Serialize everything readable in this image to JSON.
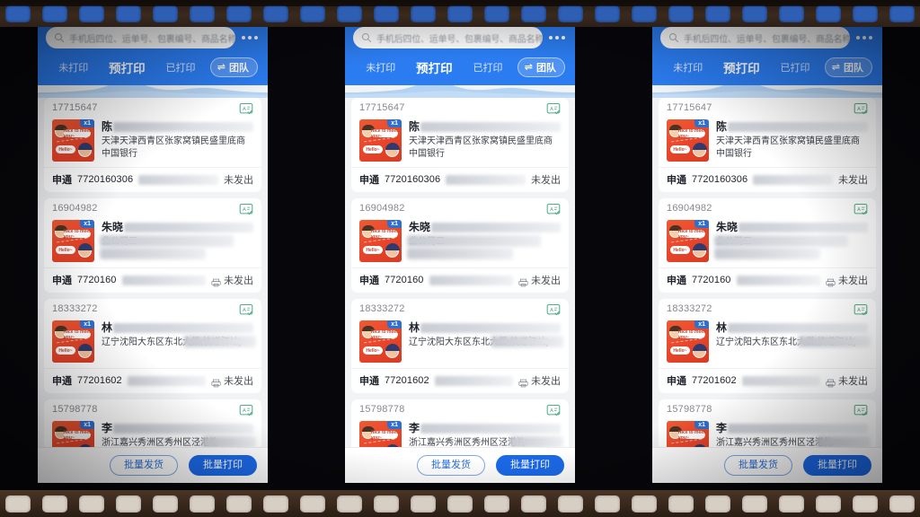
{
  "app": {
    "accent_blue": "#2b7cf0",
    "primary_button_blue": "#1b69e8",
    "status_green": "#3fa87a"
  },
  "search": {
    "placeholder": "手机后四位、运单号、包裹编号、商品名称",
    "icon": "search-icon",
    "more_icon": "more-dots-icon"
  },
  "tabs": [
    {
      "label": "未打印",
      "active": false
    },
    {
      "label": "预打印",
      "active": true
    },
    {
      "label": "已打印",
      "active": false
    }
  ],
  "team_button": {
    "label": "团队",
    "icon": "swap-icon",
    "glyph": "⇌"
  },
  "orders": [
    {
      "order_id": "17715647",
      "qty_badge": "x1",
      "name_visible": "陈",
      "address": "天津天津西青区张家窝镇民盛里底商中国银行",
      "carrier": "申通",
      "tracking": "7720160306",
      "status": "未发出",
      "has_printer_icon": false,
      "card_icon": "id-card-check-icon",
      "thumb_bubble_1": "Nice to meet you~",
      "thumb_bubble_2": "Hello~"
    },
    {
      "order_id": "16904982",
      "qty_badge": "x1",
      "name_visible": "朱晓",
      "address": "业公司三",
      "carrier": "申通",
      "tracking": "7720160",
      "status": "未发出",
      "has_printer_icon": true,
      "card_icon": "id-card-check-icon",
      "thumb_bubble_1": "Nice to meet you~",
      "thumb_bubble_2": "Hello~"
    },
    {
      "order_id": "18333272",
      "qty_badge": "x1",
      "name_visible": "林",
      "address": "辽宁沈阳大东区东北大巢,快递驿站)",
      "carrier": "申通",
      "tracking": "77201602",
      "status": "未发出",
      "has_printer_icon": true,
      "card_icon": "id-card-check-icon",
      "thumb_bubble_1": "Nice to meet you~",
      "thumb_bubble_2": "Hello~"
    },
    {
      "order_id": "15798778",
      "qty_badge": "x1",
      "name_visible": "李",
      "address": "浙江嘉兴秀洲区秀州区泾港礼",
      "carrier": "",
      "tracking": "",
      "status": "",
      "has_printer_icon": false,
      "card_icon": "id-card-check-icon",
      "thumb_bubble_1": "Nice to meet you~",
      "thumb_bubble_2": "Hello~"
    }
  ],
  "action_bar": {
    "ship_label": "批量发货",
    "print_label": "批量打印"
  }
}
